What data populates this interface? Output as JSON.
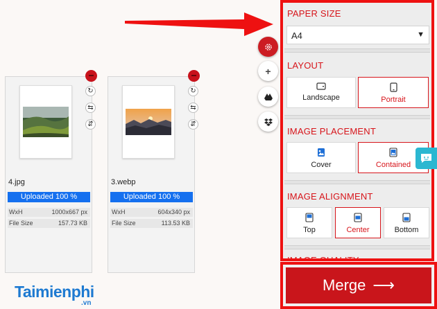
{
  "files": [
    {
      "name": "4.jpg",
      "upload_status": "Uploaded 100 %",
      "dim_label": "WxH",
      "dim_value": "1000x667 px",
      "size_label": "File Size",
      "size_value": "157.73 KB",
      "thumb": "green-hills-landscape"
    },
    {
      "name": "3.webp",
      "upload_status": "Uploaded 100 %",
      "dim_label": "WxH",
      "dim_value": "604x340 px",
      "size_label": "File Size",
      "size_value": "113.53 KB",
      "thumb": "sunset-mountains"
    }
  ],
  "file_actions": [
    "rotate-icon",
    "swap-horizontal-icon",
    "swap-vertical-icon"
  ],
  "fab_icons": [
    "settings-icon",
    "plus-icon",
    "google-drive-icon",
    "dropbox-icon"
  ],
  "panel": {
    "paper_size": {
      "title": "PAPER SIZE",
      "value": "A4",
      "caret": "▼"
    },
    "layout": {
      "title": "LAYOUT",
      "options": [
        "Landscape",
        "Portrait"
      ],
      "selected": "Portrait"
    },
    "placement": {
      "title": "IMAGE PLACEMENT",
      "options": [
        "Cover",
        "Contained"
      ],
      "selected": "Contained"
    },
    "alignment": {
      "title": "IMAGE ALIGNMENT",
      "options": [
        "Top",
        "Center",
        "Bottom"
      ],
      "selected": "Center"
    },
    "quality": {
      "title": "IMAGE QUALITY"
    }
  },
  "merge": {
    "label": "Merge",
    "arrow": "⟶"
  },
  "watermark": {
    "brand": "Taimienphi",
    "tld": ".vn"
  },
  "colors": {
    "accent": "#d7141a",
    "annotation": "#ee1111",
    "upload_bar": "#1570ef",
    "chat": "#2bb7d1"
  }
}
